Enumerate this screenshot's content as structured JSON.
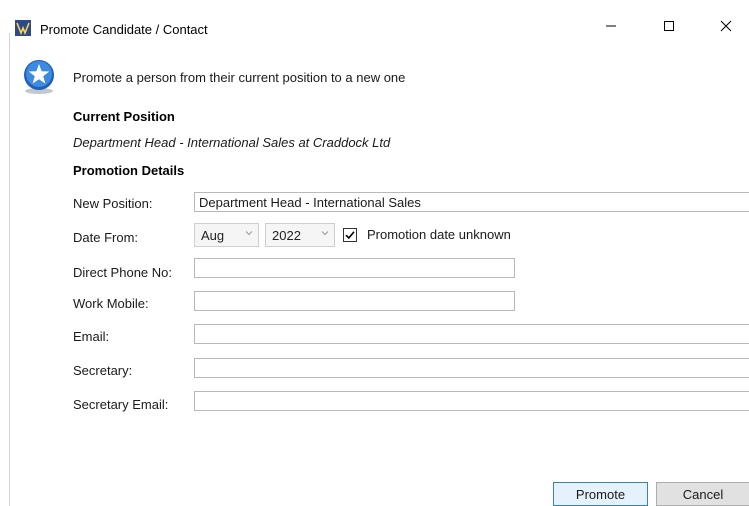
{
  "window": {
    "title": "Promote Candidate / Contact",
    "controls": {
      "minimize": "—",
      "maximize": "☐",
      "close": "✕"
    }
  },
  "header": {
    "icon": "star-badge-icon",
    "intro": "Promote a person from their current position to a new one"
  },
  "current_position": {
    "heading": "Current Position",
    "value": "Department Head - International Sales at Craddock Ltd"
  },
  "promotion_details": {
    "heading": "Promotion Details",
    "new_position": {
      "label": "New Position:",
      "value": "Department Head - International Sales"
    },
    "date_from": {
      "label": "Date From:",
      "month": "Aug",
      "year": "2022",
      "unknown_label": "Promotion date unknown",
      "unknown_checked": true
    },
    "direct_phone": {
      "label": "Direct Phone No:",
      "value": ""
    },
    "work_mobile": {
      "label": "Work Mobile:",
      "value": ""
    },
    "email": {
      "label": "Email:",
      "value": ""
    },
    "secretary": {
      "label": "Secretary:",
      "value": ""
    },
    "secretary_email": {
      "label": "Secretary Email:",
      "value": ""
    }
  },
  "buttons": {
    "promote": "Promote",
    "cancel": "Cancel"
  },
  "colors": {
    "accent": "#2b7bd6",
    "button_default_border": "#3c7fb1",
    "button_default_bg": "#e5f1fb"
  }
}
